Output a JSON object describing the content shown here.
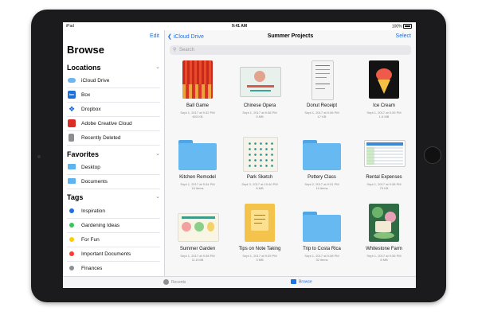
{
  "status": {
    "carrier": "iPad",
    "time": "9:41 AM",
    "battery": "100%"
  },
  "sidebar": {
    "edit_label": "Edit",
    "title": "Browse",
    "sections": {
      "locations": {
        "label": "Locations",
        "items": [
          {
            "label": "iCloud Drive",
            "icon": "cloud-icon"
          },
          {
            "label": "Box",
            "icon": "box-icon"
          },
          {
            "label": "Dropbox",
            "icon": "dropbox-icon"
          },
          {
            "label": "Adobe Creative Cloud",
            "icon": "creative-cloud-icon"
          },
          {
            "label": "Recently Deleted",
            "icon": "trash-icon"
          }
        ]
      },
      "favorites": {
        "label": "Favorites",
        "items": [
          {
            "label": "Desktop",
            "icon": "folder-icon"
          },
          {
            "label": "Documents",
            "icon": "folder-icon"
          }
        ]
      },
      "tags": {
        "label": "Tags",
        "items": [
          {
            "label": "Inspiration",
            "color": "#1f6fe0"
          },
          {
            "label": "Gardening Ideas",
            "color": "#34c759"
          },
          {
            "label": "For Fun",
            "color": "#ffcc00"
          },
          {
            "label": "Important Documents",
            "color": "#ff3b30"
          },
          {
            "label": "Finances",
            "color": "#8e8e93"
          }
        ]
      }
    }
  },
  "main": {
    "back_label": "iCloud Drive",
    "title": "Summer Projects",
    "select_label": "Select",
    "search_placeholder": "Search",
    "files": [
      {
        "name": "Ball Game",
        "date": "Sept 1, 2017 at 9:32 PM",
        "size": "603 KB",
        "kind": "image"
      },
      {
        "name": "Chinese Opera",
        "date": "Sept 1, 2017 at 9:38 PM",
        "size": "5 MB",
        "kind": "image"
      },
      {
        "name": "Donut Receipt",
        "date": "Sept 1, 2017 at 9:36 PM",
        "size": "17 KB",
        "kind": "image"
      },
      {
        "name": "Ice Cream",
        "date": "Sept 1, 2017 at 9:39 PM",
        "size": "1.6 MB",
        "kind": "image"
      },
      {
        "name": "Kitchen Remodel",
        "date": "Sept 1, 2017 at 9:34 PM",
        "size": "15 items",
        "kind": "folder"
      },
      {
        "name": "Park Sketch",
        "date": "Sept 3, 2017 at 10:40 PM",
        "size": "8 MB",
        "kind": "image"
      },
      {
        "name": "Pottery Class",
        "date": "Sept 2, 2017 at 9:31 PM",
        "size": "19 items",
        "kind": "folder"
      },
      {
        "name": "Rental Expenses",
        "date": "Sept 1, 2017 at 9:38 PM",
        "size": "75 KB",
        "kind": "image"
      },
      {
        "name": "Summer Garden",
        "date": "Sept 1, 2017 at 9:38 PM",
        "size": "11.8 MB",
        "kind": "image"
      },
      {
        "name": "Tips on Note Taking",
        "date": "Sept 1, 2017 at 9:39 PM",
        "size": "3 MB",
        "kind": "image"
      },
      {
        "name": "Trip to Costa Rica",
        "date": "Sept 1, 2017 at 9:38 PM",
        "size": "32 items",
        "kind": "folder"
      },
      {
        "name": "Whitestone Farm",
        "date": "Sept 1, 2017 at 9:36 PM",
        "size": "8 MB",
        "kind": "image"
      }
    ]
  },
  "tabbar": {
    "recents_label": "Recents",
    "browse_label": "Browse",
    "active_color": "#1a73e8"
  }
}
